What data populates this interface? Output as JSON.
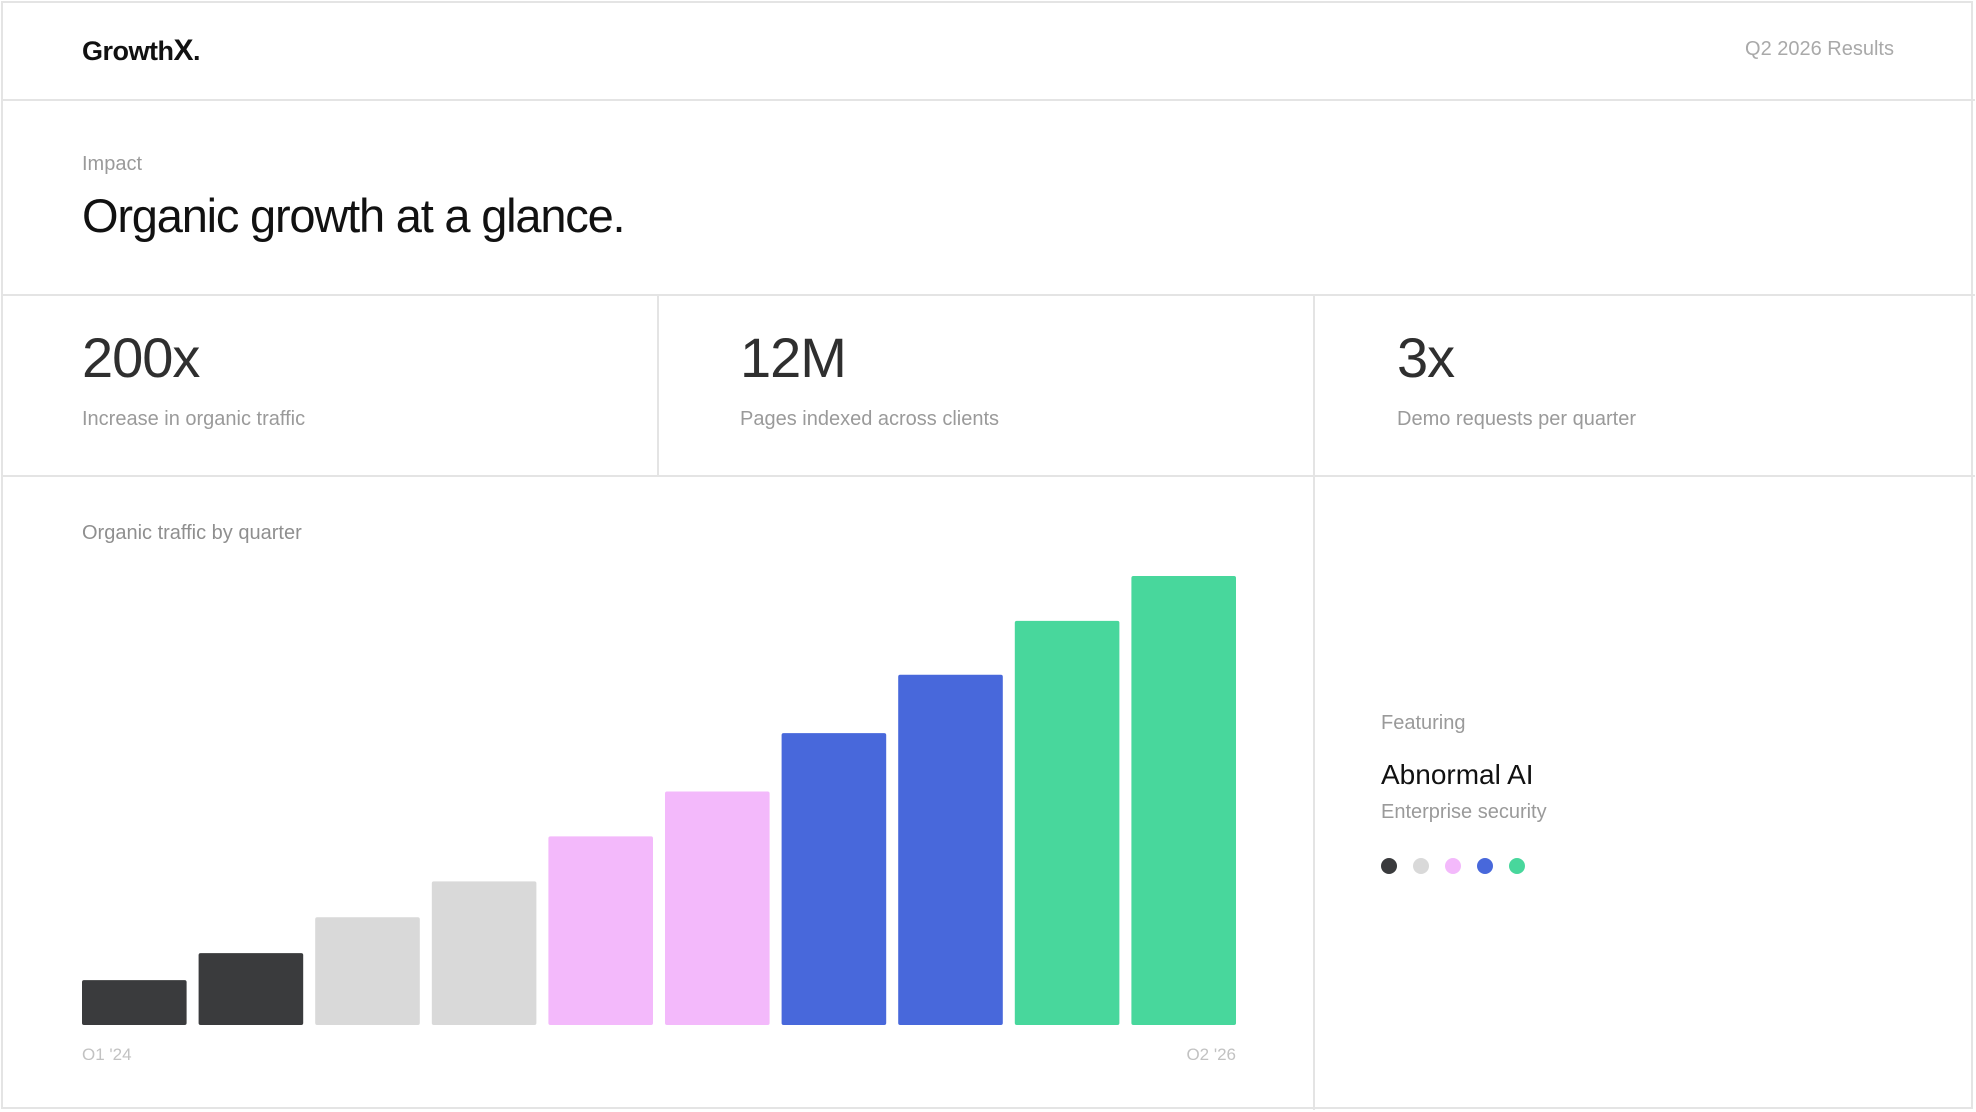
{
  "header": {
    "logo_text": "GrowthX",
    "logo_main": "Growth",
    "logo_mark": "X",
    "logo_dot": ".",
    "period": "Q2 2026 Results"
  },
  "hero": {
    "eyebrow": "Impact",
    "title": "Organic growth at a glance."
  },
  "stats": [
    {
      "value": "200x",
      "label": "Increase in organic traffic"
    },
    {
      "value": "12M",
      "label": "Pages indexed across clients"
    },
    {
      "value": "3x",
      "label": "Demo requests per quarter"
    }
  ],
  "featuring": {
    "eyebrow": "Featuring",
    "name": "Abnormal AI",
    "subtitle": "Enterprise security",
    "dot_colors": [
      "#3a3b3d",
      "#d9d9d9",
      "#f3b9fb",
      "#4868db",
      "#48d79c"
    ]
  },
  "chart_data": {
    "type": "bar",
    "title": "Organic traffic by quarter",
    "xlabel": "",
    "ylabel": "",
    "categories": [
      "Q1 '24",
      "",
      "",
      "",
      "",
      "",
      "",
      "",
      "",
      "Q2 '26"
    ],
    "values": [
      10,
      16,
      24,
      32,
      42,
      52,
      65,
      78,
      90,
      100
    ],
    "colors": [
      "#3a3b3d",
      "#3a3b3d",
      "#d9d9d9",
      "#d9d9d9",
      "#f3b9fb",
      "#f3b9fb",
      "#4868db",
      "#4868db",
      "#48d79c",
      "#48d79c"
    ],
    "ylim": [
      0,
      100
    ],
    "grid": false,
    "legend": "none"
  }
}
